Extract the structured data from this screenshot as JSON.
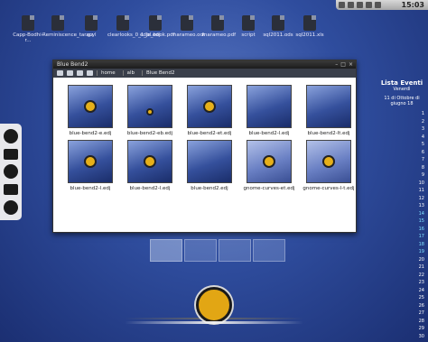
{
  "shelf": {
    "clock": "15:03"
  },
  "desktop_icons": [
    {
      "label": "Capp-Bodhi-r..."
    },
    {
      "label": "Reminiscence_tar.gz"
    },
    {
      "label": "acyl"
    },
    {
      "label": "clearlooks_0_1_bl.edj"
    },
    {
      "label": "edje_book.pdf"
    },
    {
      "label": "marameo.odt"
    },
    {
      "label": "marameo.pdf"
    },
    {
      "label": "script"
    },
    {
      "label": "sql2011.ods"
    },
    {
      "label": "sql2011.xls"
    }
  ],
  "window": {
    "title": "Blue Bend2",
    "breadcrumbs": [
      "home",
      "alb",
      "Blue Bend2"
    ],
    "files": [
      {
        "label": "blue-bend2-e.edj"
      },
      {
        "label": "blue-bend2-eb.edj"
      },
      {
        "label": "blue-bend2-et.edj"
      },
      {
        "label": "blue-bend2-l.edj"
      },
      {
        "label": "blue-bend2-lt.edj"
      },
      {
        "label": "blue-bend2-l.edj"
      },
      {
        "label": "blue-bend2-l.edj"
      },
      {
        "label": "blue-bend2.edj"
      },
      {
        "label": "gnome-curves-et.edj"
      },
      {
        "label": "gnome-curves-l-t.edj"
      }
    ]
  },
  "calendar": {
    "title": "Lista Eventi",
    "sub": "Venerdì",
    "sub2": "11 di Ottobre di giugno 18",
    "days": [
      "1",
      "2",
      "3",
      "4",
      "5",
      "6",
      "7",
      "8",
      "9",
      "10",
      "11",
      "12",
      "13",
      "14",
      "15",
      "16",
      "17",
      "18",
      "19",
      "20",
      "21",
      "22",
      "23",
      "24",
      "25",
      "26",
      "27",
      "28",
      "29",
      "30"
    ]
  }
}
